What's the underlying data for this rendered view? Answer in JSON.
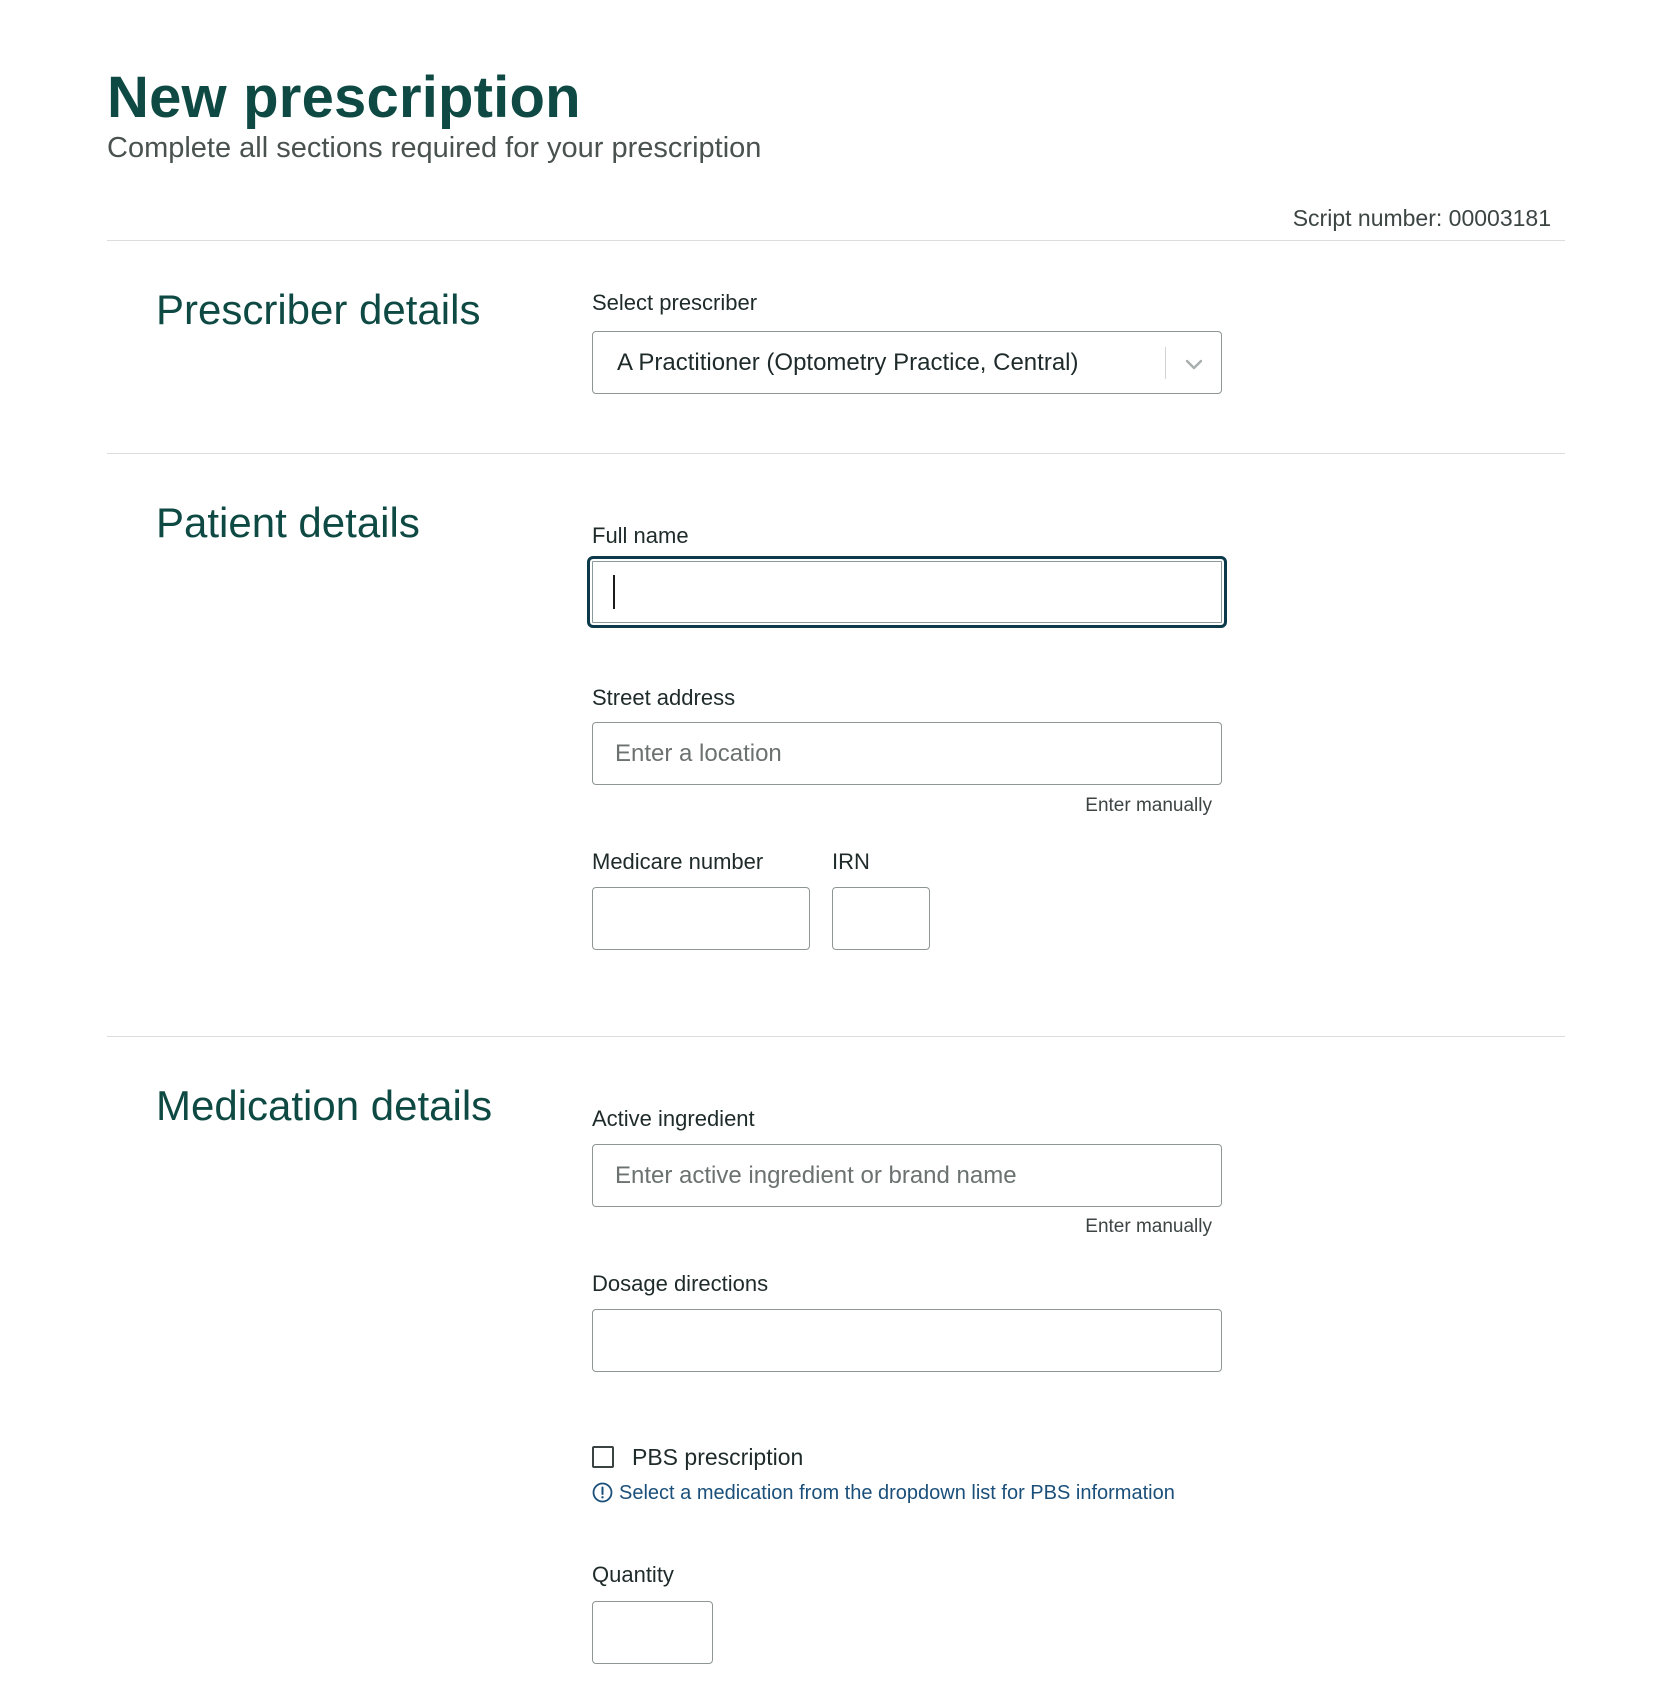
{
  "header": {
    "title": "New prescription",
    "subtitle": "Complete all sections required for your prescription",
    "script_number": "Script number: 00003181"
  },
  "prescriber": {
    "section_title": "Prescriber details",
    "select_label": "Select prescriber",
    "selected_value": "A Practitioner (Optometry Practice, Central)"
  },
  "patient": {
    "section_title": "Patient details",
    "full_name_label": "Full name",
    "full_name_value": "",
    "street_address_label": "Street address",
    "street_address_placeholder": "Enter a location",
    "enter_manually": "Enter manually",
    "medicare_label": "Medicare number",
    "irn_label": "IRN"
  },
  "medication": {
    "section_title": "Medication details",
    "active_ingredient_label": "Active ingredient",
    "active_ingredient_placeholder": "Enter active ingredient or brand name",
    "enter_manually": "Enter manually",
    "dosage_label": "Dosage directions",
    "pbs_label": "PBS prescription",
    "pbs_checked": false,
    "pbs_info": "Select a medication from the dropdown list for PBS information",
    "quantity_label": "Quantity"
  },
  "icons": {
    "dropdown": "chevron-down-icon",
    "info": "info-icon"
  },
  "colors": {
    "brand": "#0e4a43",
    "info_text": "#1a4f7a",
    "focus_border": "#0d3a4a"
  }
}
